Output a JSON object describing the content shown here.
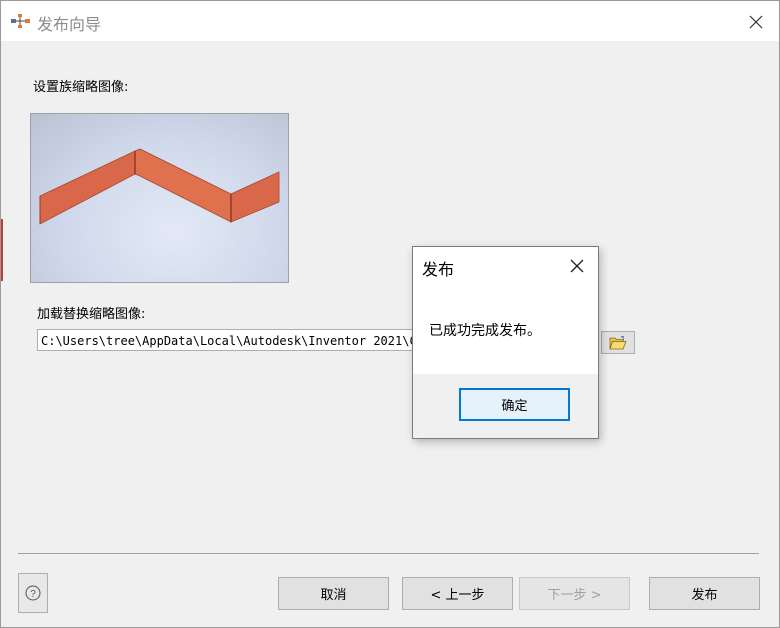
{
  "window": {
    "title": "发布向导",
    "icon": "publish-wizard-icon",
    "close_icon": "close-icon"
  },
  "thumbnail": {
    "label": "设置族缩略图像:",
    "part_color": "#d9684a"
  },
  "replace": {
    "label": "加载替换缩略图像:",
    "path_value": "C:\\Users\\tree\\AppData\\Local\\Autodesk\\Inventor 2021\\Con",
    "browse_icon": "folder-open-icon"
  },
  "footer": {
    "help_icon": "help-icon",
    "cancel_label": "取消",
    "back_label": "< 上一步",
    "next_label": "下一步 >",
    "publish_label": "发布"
  },
  "modal": {
    "title": "发布",
    "message": "已成功完成发布。",
    "ok_label": "确定",
    "accent_color": "#0078d7"
  }
}
